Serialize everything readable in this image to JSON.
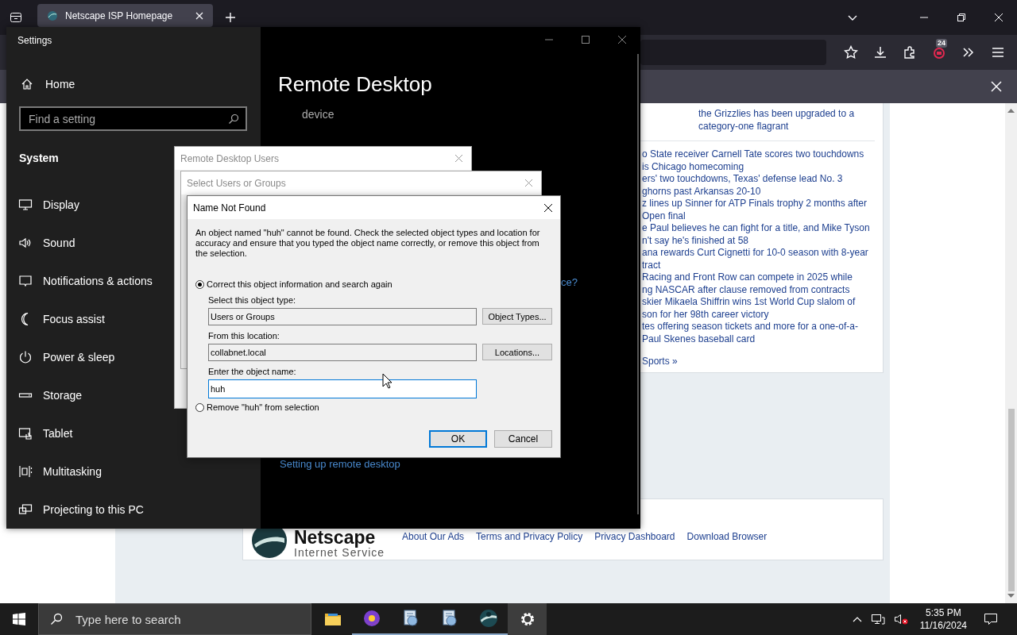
{
  "browser": {
    "tab": {
      "title": "Netscape ISP Homepage"
    },
    "badge": "24"
  },
  "page": {
    "top_story": [
      "the Grizzlies has been upgraded to a",
      "category-one flagrant"
    ],
    "news": [
      {
        "lines": [
          "o State receiver Carnell Tate scores two touchdowns",
          "is Chicago homecoming"
        ]
      },
      {
        "lines": [
          "ers' two touchdowns, Texas' defense lead No. 3",
          "ghorns past Arkansas 20-10"
        ]
      },
      {
        "lines": [
          "z lines up Sinner for ATP Finals trophy 2 months after",
          "Open final"
        ]
      },
      {
        "lines": [
          "e Paul believes he can fight for a title, and Mike Tyson",
          "n't say he's finished at 58"
        ]
      },
      {
        "lines": [
          "ana rewards Curt Cignetti for 10-0 season with 8-year",
          "tract"
        ]
      },
      {
        "lines": [
          "Racing and Front Row can compete in 2025 while",
          "ng NASCAR after clause removed from contracts"
        ]
      },
      {
        "lines": [
          "skier Mikaela Shiffrin wins 1st World Cup slalom of",
          "son for her 98th career victory"
        ]
      },
      {
        "lines": [
          "tes offering season tickets and more for a one-of-a-",
          "Paul Skenes baseball card"
        ]
      }
    ],
    "more_link": "Sports »",
    "footer": {
      "logo_name": "Netscape",
      "logo_sub": "Internet Service",
      "links": [
        "About Our Ads",
        "Terms and Privacy Policy",
        "Privacy Dashboard",
        "Download Browser"
      ]
    }
  },
  "settings": {
    "title": "Settings",
    "home": "Home",
    "search": {
      "placeholder": "Find a setting"
    },
    "section": "System",
    "nav": [
      {
        "label": "Display",
        "kind": "display"
      },
      {
        "label": "Sound",
        "kind": "sound"
      },
      {
        "label": "Notifications & actions",
        "kind": "notifications"
      },
      {
        "label": "Focus assist",
        "kind": "focus"
      },
      {
        "label": "Power & sleep",
        "kind": "power"
      },
      {
        "label": "Storage",
        "kind": "storage"
      },
      {
        "label": "Tablet",
        "kind": "tablet"
      },
      {
        "label": "Multitasking",
        "kind": "multitasking"
      },
      {
        "label": "Projecting to this PC",
        "kind": "projecting"
      }
    ],
    "page_title": "Remote Desktop",
    "device_text": "device",
    "link_fragment": "ce?",
    "help_link": "Setting up remote desktop"
  },
  "back_dialogs": [
    {
      "title": "Remote Desktop Users"
    },
    {
      "title": "Select Users or Groups"
    }
  ],
  "dialog": {
    "title": "Name Not Found",
    "message": "An object named \"huh\" cannot be found. Check the selected object types and location for accuracy and ensure that you typed the object name correctly, or remove this object from the selection.",
    "options": [
      {
        "label": "Correct this object information and search again",
        "selected": true
      },
      {
        "label": "Remove \"huh\" from selection",
        "selected": false
      }
    ],
    "fields": [
      {
        "label": "Select this object type:",
        "value": "Users or Groups",
        "button": "Object Types...",
        "focused": false
      },
      {
        "label": "From this location:",
        "value": "collabnet.local",
        "button": "Locations...",
        "focused": false
      },
      {
        "label": "Enter the object name:",
        "value": "huh",
        "focused": true
      }
    ],
    "buttons": [
      {
        "label": "OK",
        "default": true
      },
      {
        "label": "Cancel",
        "default": false
      }
    ]
  },
  "taskbar": {
    "search_placeholder": "Type here to search",
    "apps": [
      {
        "kind": "folder",
        "running": false,
        "selected": false
      },
      {
        "kind": "browser",
        "running": true,
        "selected": false
      },
      {
        "kind": "app",
        "running": true,
        "selected": false
      },
      {
        "kind": "app",
        "running": true,
        "selected": false
      },
      {
        "kind": "netscape",
        "running": true,
        "selected": false
      },
      {
        "kind": "gear",
        "running": false,
        "selected": true
      }
    ],
    "time": "5:35 PM",
    "date": "11/16/2024"
  }
}
